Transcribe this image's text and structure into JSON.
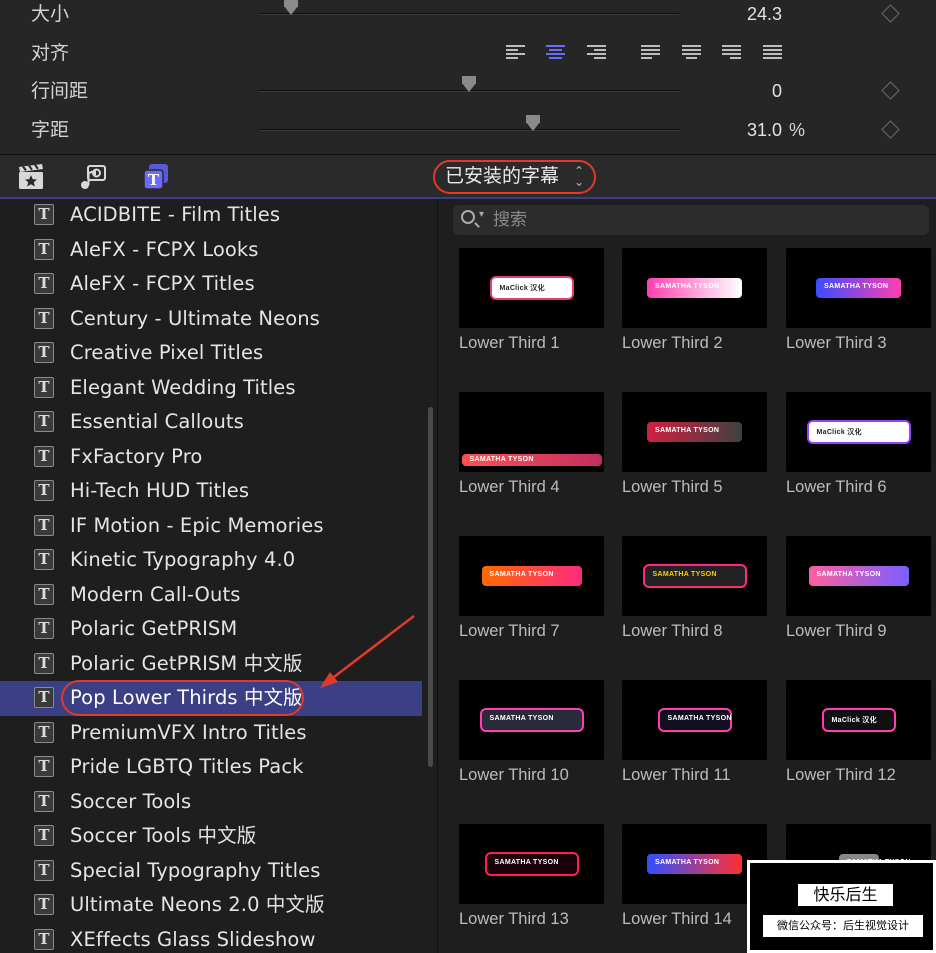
{
  "inspector": {
    "rows": [
      {
        "label": "大小",
        "value": "24.3",
        "unit": "",
        "knob_fraction": 0.08
      },
      {
        "label": "对齐"
      },
      {
        "label": "行间距",
        "value": "0",
        "unit": "",
        "knob_fraction": 0.5
      },
      {
        "label": "字距",
        "value": "31.0",
        "unit": "%",
        "knob_fraction": 0.65
      }
    ],
    "alignment_options": [
      "align-left",
      "align-center",
      "align-right",
      "justify-left",
      "justify-center",
      "justify-right",
      "justify-full"
    ],
    "alignment_selected": "align-center"
  },
  "toolbar": {
    "icons": [
      "clapper-star-icon",
      "music-photo-icon",
      "titles-icon"
    ],
    "active_icon": "titles-icon",
    "popup_label": "已安装的字幕"
  },
  "sidebar": {
    "items": [
      {
        "label": "ACIDBITE - Film Titles"
      },
      {
        "label": "AleFX - FCPX Looks"
      },
      {
        "label": "AleFX - FCPX Titles"
      },
      {
        "label": "Century - Ultimate Neons"
      },
      {
        "label": "Creative Pixel Titles"
      },
      {
        "label": "Elegant Wedding Titles"
      },
      {
        "label": "Essential Callouts"
      },
      {
        "label": "FxFactory Pro"
      },
      {
        "label": "Hi-Tech HUD Titles"
      },
      {
        "label": "IF Motion - Epic Memories"
      },
      {
        "label": "Kinetic Typography 4.0"
      },
      {
        "label": "Modern Call-Outs"
      },
      {
        "label": "Polaric GetPRISM"
      },
      {
        "label": "Polaric GetPRISM 中文版"
      },
      {
        "label": "Pop Lower Thirds 中文版",
        "selected": true
      },
      {
        "label": "PremiumVFX Intro Titles"
      },
      {
        "label": "Pride LGBTQ Titles Pack"
      },
      {
        "label": "Soccer Tools"
      },
      {
        "label": "Soccer Tools 中文版"
      },
      {
        "label": "Special Typography Titles"
      },
      {
        "label": "Ultimate Neons 2.0 中文版"
      },
      {
        "label": "XEffects Glass Slideshow"
      }
    ],
    "t_glyph": "T"
  },
  "browser": {
    "search_placeholder": "搜索",
    "tiles": [
      {
        "label": "Lower Third 1",
        "thumb_text": "MaClick 汉化"
      },
      {
        "label": "Lower Third 2",
        "thumb_text": "SAMATHA TYSON"
      },
      {
        "label": "Lower Third 3",
        "thumb_text": "SAMATHA TYSON"
      },
      {
        "label": "Lower Third 4",
        "thumb_text": "SAMATHA TYSON"
      },
      {
        "label": "Lower Third 5",
        "thumb_text": "SAMATHA TYSON"
      },
      {
        "label": "Lower Third 6",
        "thumb_text": "MaClick 汉化"
      },
      {
        "label": "Lower Third 7",
        "thumb_text": "SAMATHA TYSON"
      },
      {
        "label": "Lower Third 8",
        "thumb_text": "SAMATHA TYSON"
      },
      {
        "label": "Lower Third 9",
        "thumb_text": "SAMATHA TYSON"
      },
      {
        "label": "Lower Third 10",
        "thumb_text": "SAMATHA TYSON"
      },
      {
        "label": "Lower Third 11",
        "thumb_text": "SAMATHA TYSON"
      },
      {
        "label": "Lower Third 12",
        "thumb_text": "MaClick 汉化"
      },
      {
        "label": "Lower Third 13",
        "thumb_text": "SAMATHA TYSON"
      },
      {
        "label": "Lower Third 14",
        "thumb_text": "SAMATHA TYSON"
      },
      {
        "label": "",
        "thumb_text": "SAMATHA TYSON"
      }
    ]
  },
  "watermark": {
    "title": "快乐后生",
    "subtitle": "微信公众号：后生视觉设计"
  },
  "colors": {
    "accent": "#6b6bff",
    "selection": "#3a3f86",
    "annotation": "#e23a2a"
  }
}
